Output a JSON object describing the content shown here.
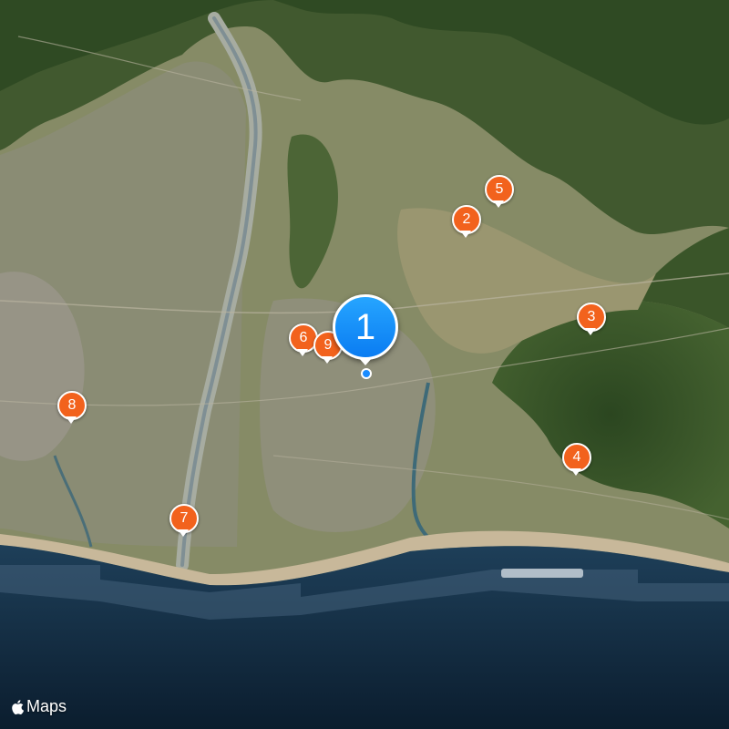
{
  "map": {
    "type": "satellite",
    "colors": {
      "land": "#7f8a60",
      "forest": "#3d5a2c",
      "urban": "#8b8b76",
      "sea": "#0f2539",
      "marker": "#f2621d",
      "selected_marker": "#1a8cff"
    }
  },
  "markers": [
    {
      "label": "1",
      "selected": true,
      "icon": "location-dot"
    },
    {
      "label": "2"
    },
    {
      "label": "3"
    },
    {
      "label": "4"
    },
    {
      "label": "5"
    },
    {
      "label": "6"
    },
    {
      "label": "7"
    },
    {
      "label": "8"
    },
    {
      "label": "9"
    }
  ],
  "attribution": {
    "brand": "Maps",
    "icon": "apple-icon"
  }
}
